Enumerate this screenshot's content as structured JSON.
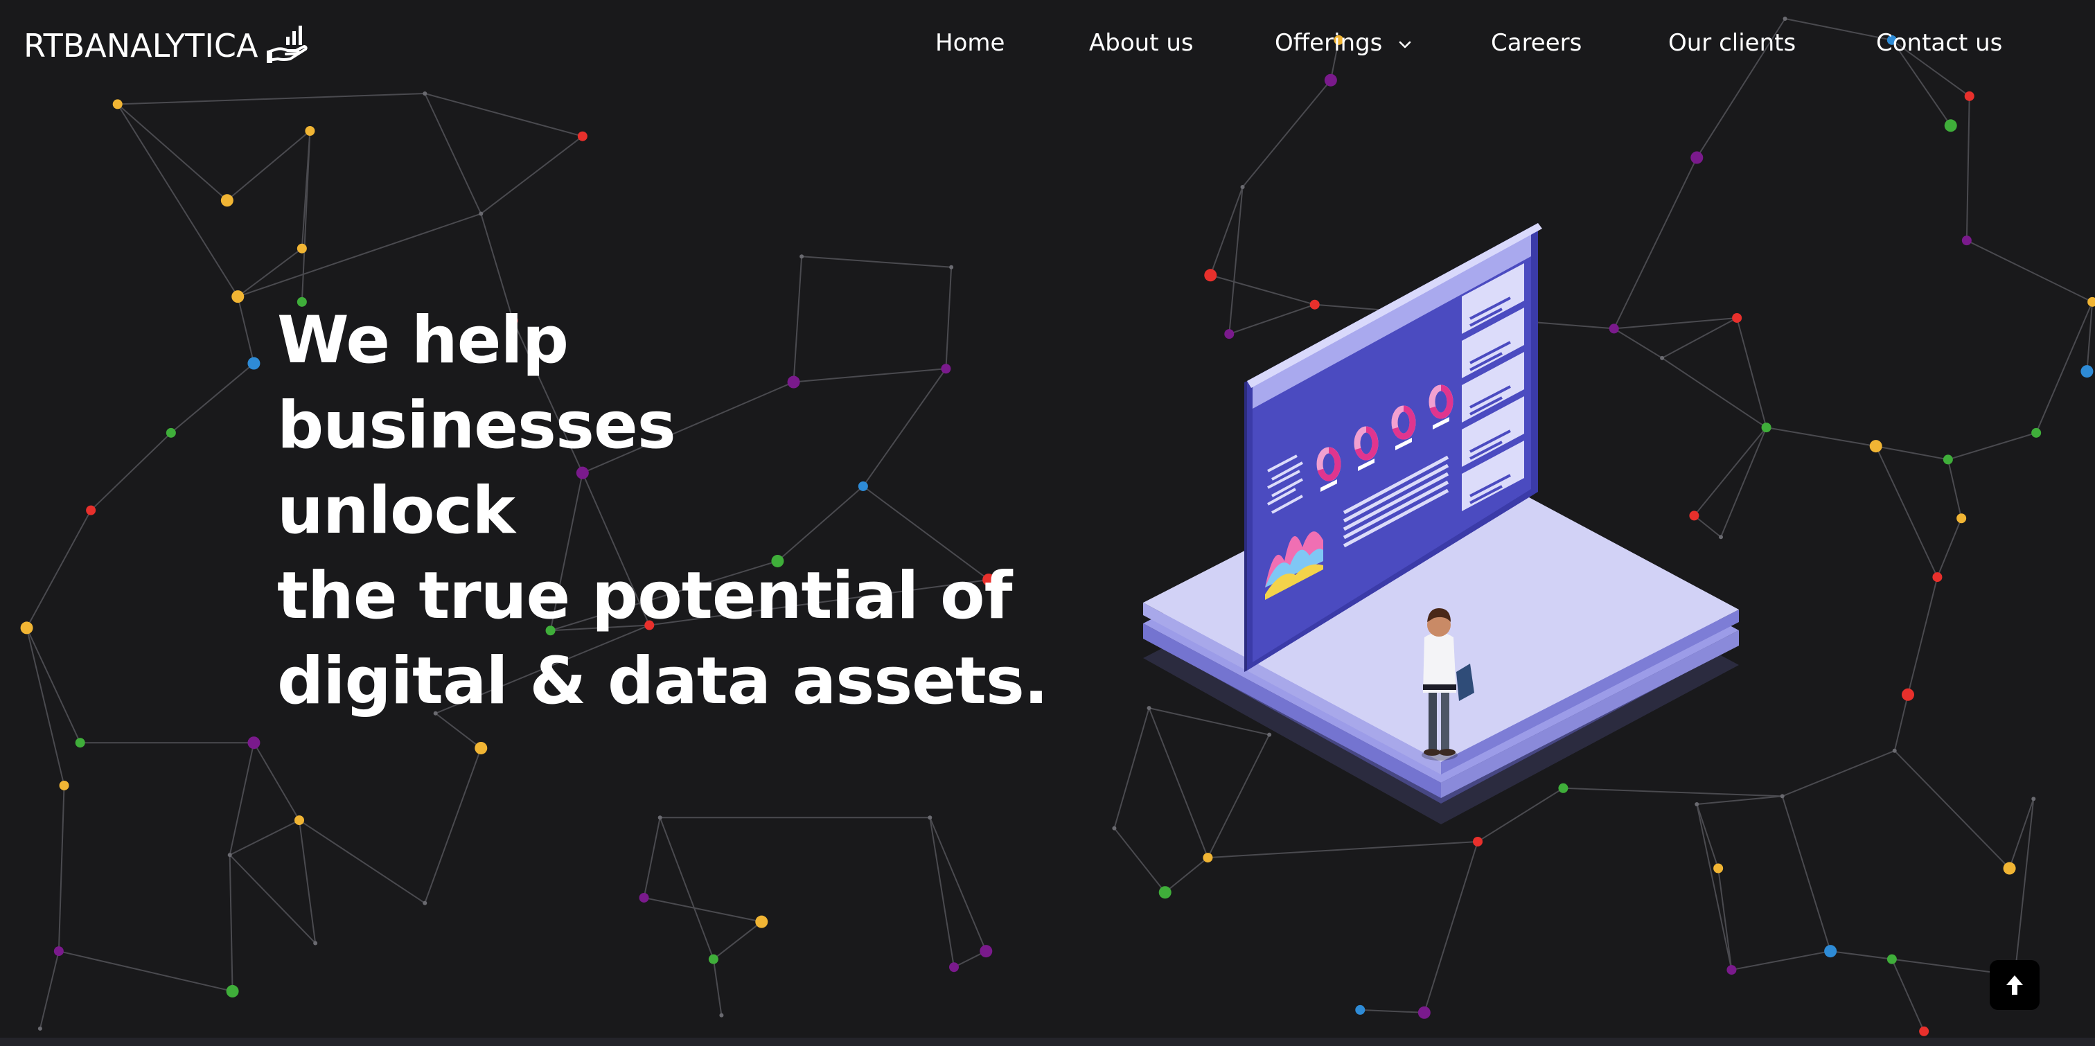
{
  "brand": {
    "name": "RTBANALYTICA",
    "logo_icon": "hand-holding-chart-icon"
  },
  "nav": {
    "home": "Home",
    "about": "About us",
    "offerings": "Offerings",
    "careers": "Careers",
    "clients": "Our clients",
    "contact": "Contact us",
    "offerings_icon": "chevron-down-icon"
  },
  "hero": {
    "lines": [
      "We help",
      "businesses",
      "unlock",
      "the true potential of",
      "digital & data assets."
    ],
    "illustration_icon": "isometric-dashboard-illustration"
  },
  "scroll_top": {
    "icon": "arrow-up-icon"
  },
  "colors": {
    "background": "#19191b",
    "text": "#ffffff",
    "network_line": "#4a4a4f",
    "node_red": "#e8302c",
    "node_purple": "#7a1a8c",
    "node_green": "#3fae3a",
    "node_yellow": "#f1b534",
    "node_blue": "#2e8bd6",
    "screen_blue": "#4a4abf",
    "platform_light": "#c9c9f2"
  }
}
